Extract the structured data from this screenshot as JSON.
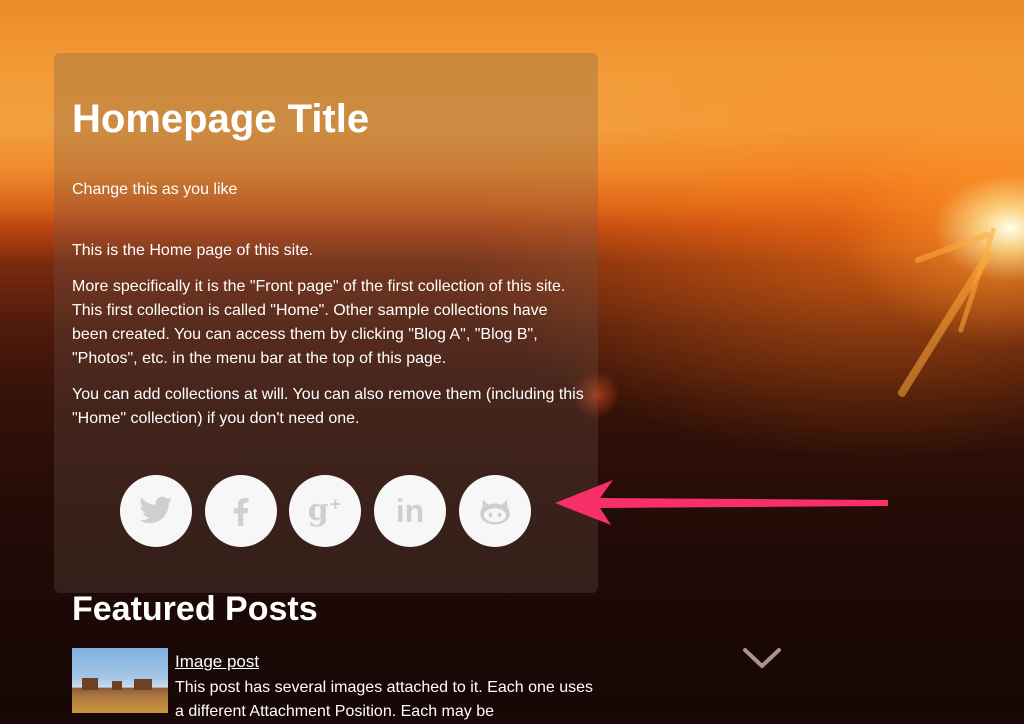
{
  "header": {
    "title": "Homepage Title",
    "subtitle": "Change this as you like"
  },
  "intro": {
    "paragraphs": [
      "This is the Home page of this site.",
      "More specifically it is the \"Front page\" of the first collection of this site. This first collection is called \"Home\". Other sample collections have been created. You can access them by clicking \"Blog A\", \"Blog B\", \"Photos\", etc. in the menu bar at the top of this page.",
      "You can add collections at will. You can also remove them (including this \"Home\" collection) if you don't need one."
    ]
  },
  "social": {
    "items": [
      {
        "icon": "twitter-icon"
      },
      {
        "icon": "facebook-icon"
      },
      {
        "icon": "google-plus-icon",
        "glyph": "g",
        "plus": "+"
      },
      {
        "icon": "linkedin-icon",
        "glyph": "in"
      },
      {
        "icon": "github-icon"
      }
    ],
    "icon_color": "#cfcfcf",
    "button_bg": "#f7f7f7"
  },
  "annotation": {
    "arrow_color": "#f7306a"
  },
  "featured": {
    "title": "Featured Posts",
    "posts": [
      {
        "title": "Image post",
        "excerpt": "This post has several images attached to it. Each one uses a different Attachment Position. Each may be"
      }
    ]
  },
  "nav": {
    "scroll_down_icon": "chevron-down-icon"
  }
}
